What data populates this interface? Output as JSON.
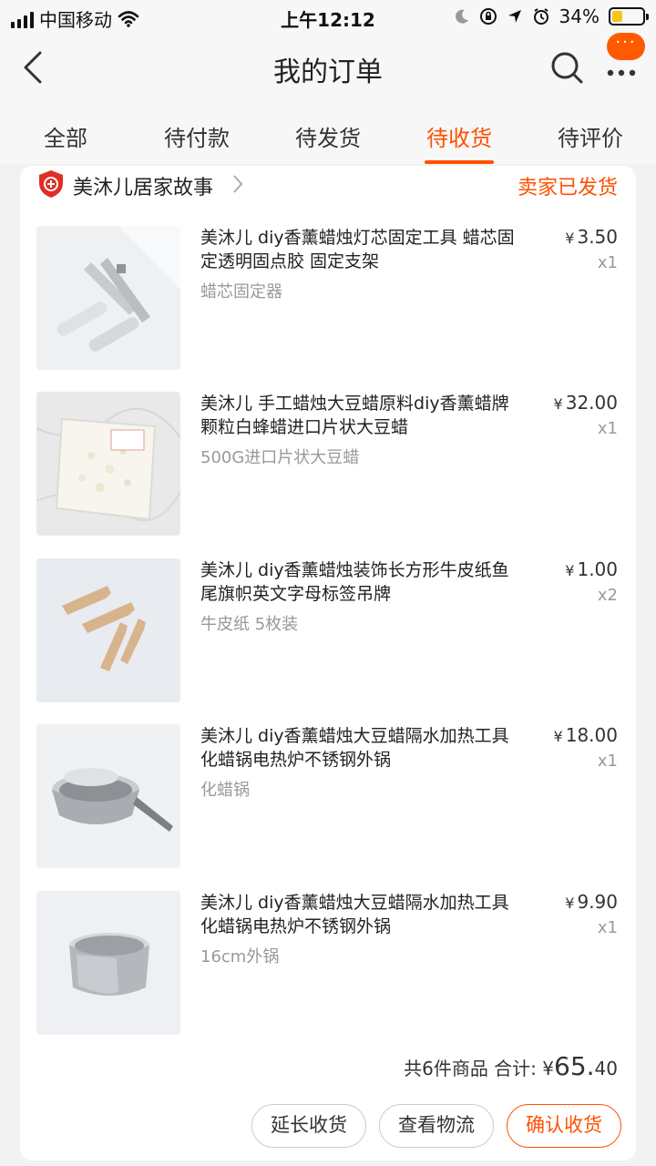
{
  "status_bar": {
    "carrier": "中国移动",
    "time": "上午12:12",
    "battery": "34%",
    "battery_level": 0.34
  },
  "nav": {
    "title": "我的订单",
    "notification_badge": "···",
    "icons": [
      "back-chevron-icon",
      "search-icon",
      "more-icon"
    ]
  },
  "tabs": [
    {
      "label": "全部"
    },
    {
      "label": "待付款"
    },
    {
      "label": "待发货"
    },
    {
      "label": "待收货",
      "active": true
    },
    {
      "label": "待评价"
    }
  ],
  "order": {
    "shop_name": "美沐儿居家故事",
    "status": "卖家已发货",
    "items": [
      {
        "title": "美沐儿 diy香薰蜡烛灯芯固定工具 蜡芯固定透明固点胶 固定支架",
        "variant": "蜡芯固定器",
        "price": "3.50",
        "qty": "x1"
      },
      {
        "title": "美沐儿 手工蜡烛大豆蜡原料diy香薰蜡牌颗粒白蜂蜡进口片状大豆蜡",
        "variant": "500G进口片状大豆蜡",
        "price": "32.00",
        "qty": "x1"
      },
      {
        "title": "美沐儿 diy香薰蜡烛装饰长方形牛皮纸鱼尾旗帜英文字母标签吊牌",
        "variant": "牛皮纸 5枚装",
        "price": "1.00",
        "qty": "x2"
      },
      {
        "title": "美沐儿 diy香薰蜡烛大豆蜡隔水加热工具 化蜡锅电热炉不锈钢外锅",
        "variant": "化蜡锅",
        "price": "18.00",
        "qty": "x1"
      },
      {
        "title": "美沐儿 diy香薰蜡烛大豆蜡隔水加热工具 化蜡锅电热炉不锈钢外锅",
        "variant": "16cm外锅",
        "price": "9.90",
        "qty": "x1"
      }
    ],
    "currency": "¥",
    "summary_prefix": "共6件商品 合计:",
    "total_int": "65.",
    "total_dec": "40",
    "buttons": {
      "extend": "延长收货",
      "logistics": "查看物流",
      "confirm": "确认收货"
    }
  },
  "colors": {
    "accent": "#ff5000",
    "secondary_text": "#999999",
    "background": "#f2f2f2"
  }
}
